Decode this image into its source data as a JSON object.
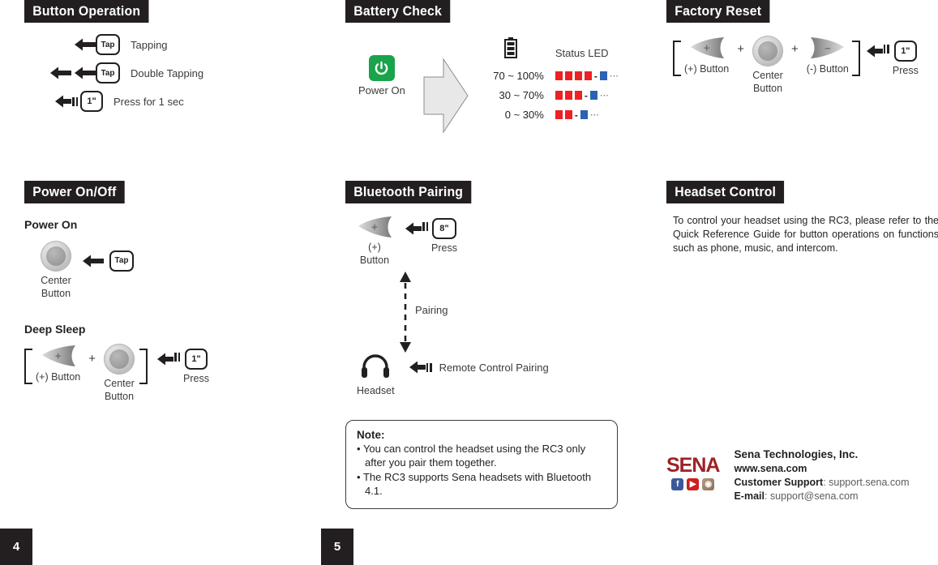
{
  "sections": {
    "button_operation": {
      "title": "Button Operation",
      "rows": [
        {
          "key": "Tap",
          "label": "Tapping",
          "arrows": 1,
          "bars": 0
        },
        {
          "key": "Tap",
          "label": "Double Tapping",
          "arrows": 2,
          "bars": 0
        },
        {
          "key": "1\"",
          "label": "Press for 1 sec",
          "arrows": 1,
          "bars": 2
        }
      ]
    },
    "power_on_off": {
      "title": "Power On/Off",
      "power_on": {
        "heading": "Power On",
        "button_caption": "Center\nButton",
        "button_caption_l1": "Center",
        "button_caption_l2": "Button",
        "key": "Tap"
      },
      "deep_sleep": {
        "heading": "Deep Sleep",
        "plus_button_caption": "(+) Button",
        "plus_sign": "+",
        "center_button_l1": "Center",
        "center_button_l2": "Button",
        "key": "1\"",
        "key_caption": "Press"
      }
    },
    "battery_check": {
      "title": "Battery Check",
      "power_on_label": "Power On",
      "status_led_label": "Status LED",
      "rows": [
        {
          "range": "70 ~ 100%",
          "red": 4,
          "blue": 1,
          "dots": "⋯"
        },
        {
          "range": "30 ~ 70%",
          "red": 3,
          "blue": 1,
          "dots": "⋯"
        },
        {
          "range": "0 ~ 30%",
          "red": 2,
          "blue": 1,
          "dots": "⋯"
        }
      ],
      "separator": "-"
    },
    "bluetooth_pairing": {
      "title": "Bluetooth Pairing",
      "plus_button_l1": "(+)",
      "plus_button_l2": "Button",
      "key": "8\"",
      "key_caption": "Press",
      "pairing_label": "Pairing",
      "headset_label": "Headset",
      "remote_label": "Remote Control Pairing"
    },
    "note": {
      "heading": "Note:",
      "items": [
        "You can control the headset using the RC3 only after you pair them together.",
        "The RC3 supports Sena headsets with Bluetooth 4.1."
      ]
    },
    "factory_reset": {
      "title": "Factory Reset",
      "plus_button_caption": "(+) Button",
      "plus_sign_1": "+",
      "center_button_l1": "Center",
      "center_button_l2": "Button",
      "plus_sign_2": "+",
      "minus_button_caption": "(-) Button",
      "key": "1\"",
      "key_caption": "Press"
    },
    "headset_control": {
      "title": "Headset Control",
      "paragraph": "To control your headset using the RC3, please refer to the Quick Reference Guide for button operations on functions such as phone, music, and intercom."
    },
    "footer": {
      "logo": "SENA",
      "company": "Sena Technologies, Inc.",
      "website": "www.sena.com",
      "support_label": "Customer Support",
      "support_value": ": support.sena.com",
      "email_label": "E-mail",
      "email_value": ": support@sena.com",
      "social": [
        "facebook-icon",
        "youtube-icon",
        "instagram-icon"
      ]
    }
  },
  "page_numbers": {
    "left": "4",
    "right": "5"
  },
  "colors": {
    "ink": "#231f20",
    "led_red": "#ed2024",
    "led_blue": "#2a62b6",
    "power_green": "#19a34a",
    "sena_red": "#9d2226"
  }
}
